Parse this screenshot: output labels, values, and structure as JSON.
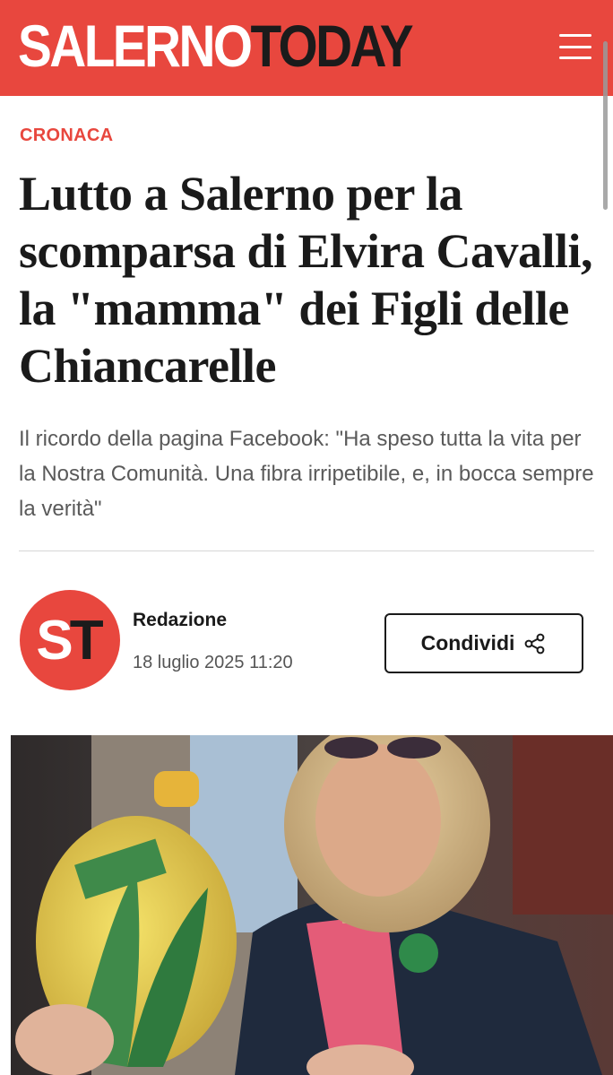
{
  "colors": {
    "brand": "#e8473e"
  },
  "header": {
    "logo_part1": "SALERNO",
    "logo_part2": "TODAY",
    "menu_icon": "hamburger-menu-icon"
  },
  "article": {
    "category": "CRONACA",
    "title": "Lutto a Salerno per la scomparsa di Elvira Cavalli, la \"mamma\" dei Figli delle Chiancarelle",
    "subtitle": "Il ricordo della pagina Facebook: \"Ha speso tutta la vita per la Nostra Comunità. Una fibra irripetibile, e, in bocca sempre la verità\"",
    "author": {
      "avatar_text_1": "S",
      "avatar_text_2": "T",
      "name": "Redazione",
      "date": "18 luglio 2025 11:20"
    },
    "share": {
      "label": "Condividi",
      "icon": "share-icon"
    }
  }
}
